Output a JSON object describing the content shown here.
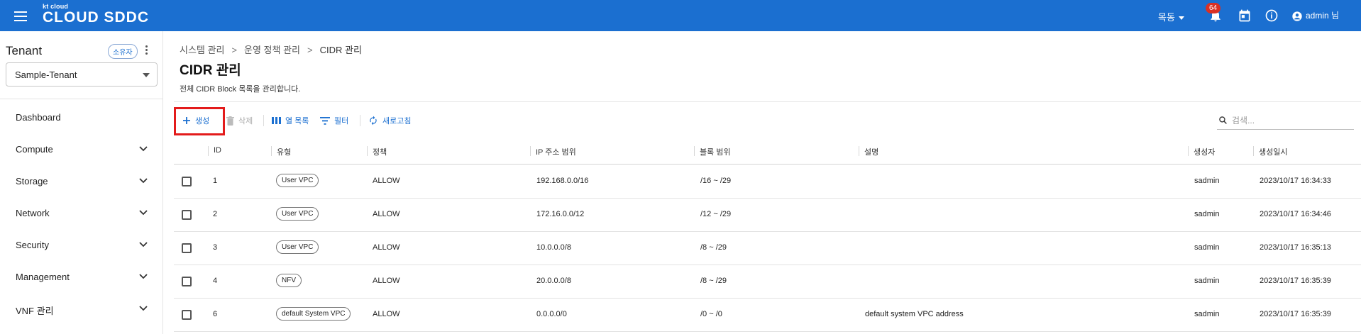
{
  "header": {
    "logo_small": "kt cloud",
    "logo_big": "CLOUD SDDC",
    "language": "목동",
    "notification_count": "64",
    "user": "admin 님"
  },
  "sidebar": {
    "tenant_label": "Tenant",
    "owner_chip": "소유자",
    "tenant_selected": "Sample-Tenant",
    "items": [
      {
        "label": "Dashboard"
      },
      {
        "label": "Compute"
      },
      {
        "label": "Storage"
      },
      {
        "label": "Network"
      },
      {
        "label": "Security"
      },
      {
        "label": "Management"
      },
      {
        "label": "VNF 관리"
      }
    ]
  },
  "breadcrumb": [
    "시스템 관리",
    "운영 정책 관리",
    "CIDR 관리"
  ],
  "page": {
    "title": "CIDR 관리",
    "description": "전체 CIDR Block 목록을 관리합니다."
  },
  "toolbar": {
    "create": "생성",
    "delete": "삭제",
    "columns": "열 목록",
    "filter": "필터",
    "refresh": "새로고침",
    "search_placeholder": "검색..."
  },
  "table": {
    "columns": [
      "ID",
      "유형",
      "정책",
      "IP 주소 범위",
      "블록 범위",
      "설명",
      "생성자",
      "생성일시"
    ],
    "rows": [
      {
        "id": "1",
        "type": "User VPC",
        "policy": "ALLOW",
        "ip_range": "192.168.0.0/16",
        "block_range": "/16 ~ /29",
        "desc": "",
        "creator": "sadmin",
        "created": "2023/10/17 16:34:33"
      },
      {
        "id": "2",
        "type": "User VPC",
        "policy": "ALLOW",
        "ip_range": "172.16.0.0/12",
        "block_range": "/12 ~ /29",
        "desc": "",
        "creator": "sadmin",
        "created": "2023/10/17 16:34:46"
      },
      {
        "id": "3",
        "type": "User VPC",
        "policy": "ALLOW",
        "ip_range": "10.0.0.0/8",
        "block_range": "/8 ~ /29",
        "desc": "",
        "creator": "sadmin",
        "created": "2023/10/17 16:35:13"
      },
      {
        "id": "4",
        "type": "NFV",
        "policy": "ALLOW",
        "ip_range": "20.0.0.0/8",
        "block_range": "/8 ~ /29",
        "desc": "",
        "creator": "sadmin",
        "created": "2023/10/17 16:35:39"
      },
      {
        "id": "6",
        "type": "default System VPC",
        "policy": "ALLOW",
        "ip_range": "0.0.0.0/0",
        "block_range": "/0 ~ /0",
        "desc": "default system VPC address",
        "creator": "sadmin",
        "created": "2023/10/17 16:35:39"
      }
    ]
  },
  "colors": {
    "brand": "#1b6fd0",
    "highlight": "#e31b1b",
    "badge": "#d93025"
  },
  "icons": [
    "menu-icon",
    "bell-icon",
    "calendar-icon",
    "info-icon",
    "account-icon",
    "kebab-icon",
    "chevron-down-icon",
    "plus-icon",
    "trash-icon",
    "columns-icon",
    "filter-icon",
    "refresh-icon",
    "search-icon"
  ]
}
